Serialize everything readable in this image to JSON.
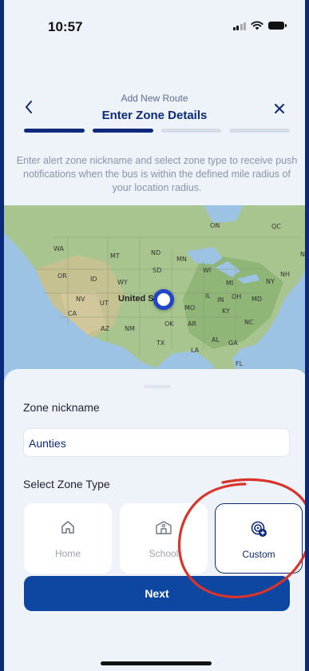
{
  "status_bar": {
    "time": "10:57"
  },
  "header": {
    "subtitle": "Add New Route",
    "title": "Enter Zone Details",
    "back_icon": "chevron-left",
    "close_icon": "close"
  },
  "progress": {
    "total_steps": 4,
    "completed_steps": 2
  },
  "description": "Enter alert zone nickname and select zone type to receive push notifications when the bus is within the defined mile radius of your location radius.",
  "map": {
    "country_label": "United S",
    "region_labels": [
      "WA",
      "MT",
      "ND",
      "MN",
      "ON",
      "QC",
      "OR",
      "ID",
      "SD",
      "WY",
      "WI",
      "MI",
      "NY",
      "NH",
      "NB",
      "NV",
      "UT",
      "IL",
      "IN",
      "OH",
      "MD",
      "CA",
      "MO",
      "KY",
      "AZ",
      "NM",
      "OK",
      "AR",
      "NC",
      "TX",
      "AL",
      "GA",
      "LA",
      "FL"
    ]
  },
  "form": {
    "nickname_label": "Zone nickname",
    "nickname_value": "Aunties",
    "zone_type_label": "Select Zone Type",
    "zone_types": [
      {
        "label": "Home",
        "icon": "home-icon",
        "selected": false
      },
      {
        "label": "School",
        "icon": "school-icon",
        "selected": false
      },
      {
        "label": "Custom",
        "icon": "custom-location-icon",
        "selected": true
      }
    ]
  },
  "next_label": "Next",
  "colors": {
    "brand": "#0d2a7a",
    "button": "#0d47a1",
    "annotation": "#d9342b",
    "background": "#eef3fa"
  }
}
